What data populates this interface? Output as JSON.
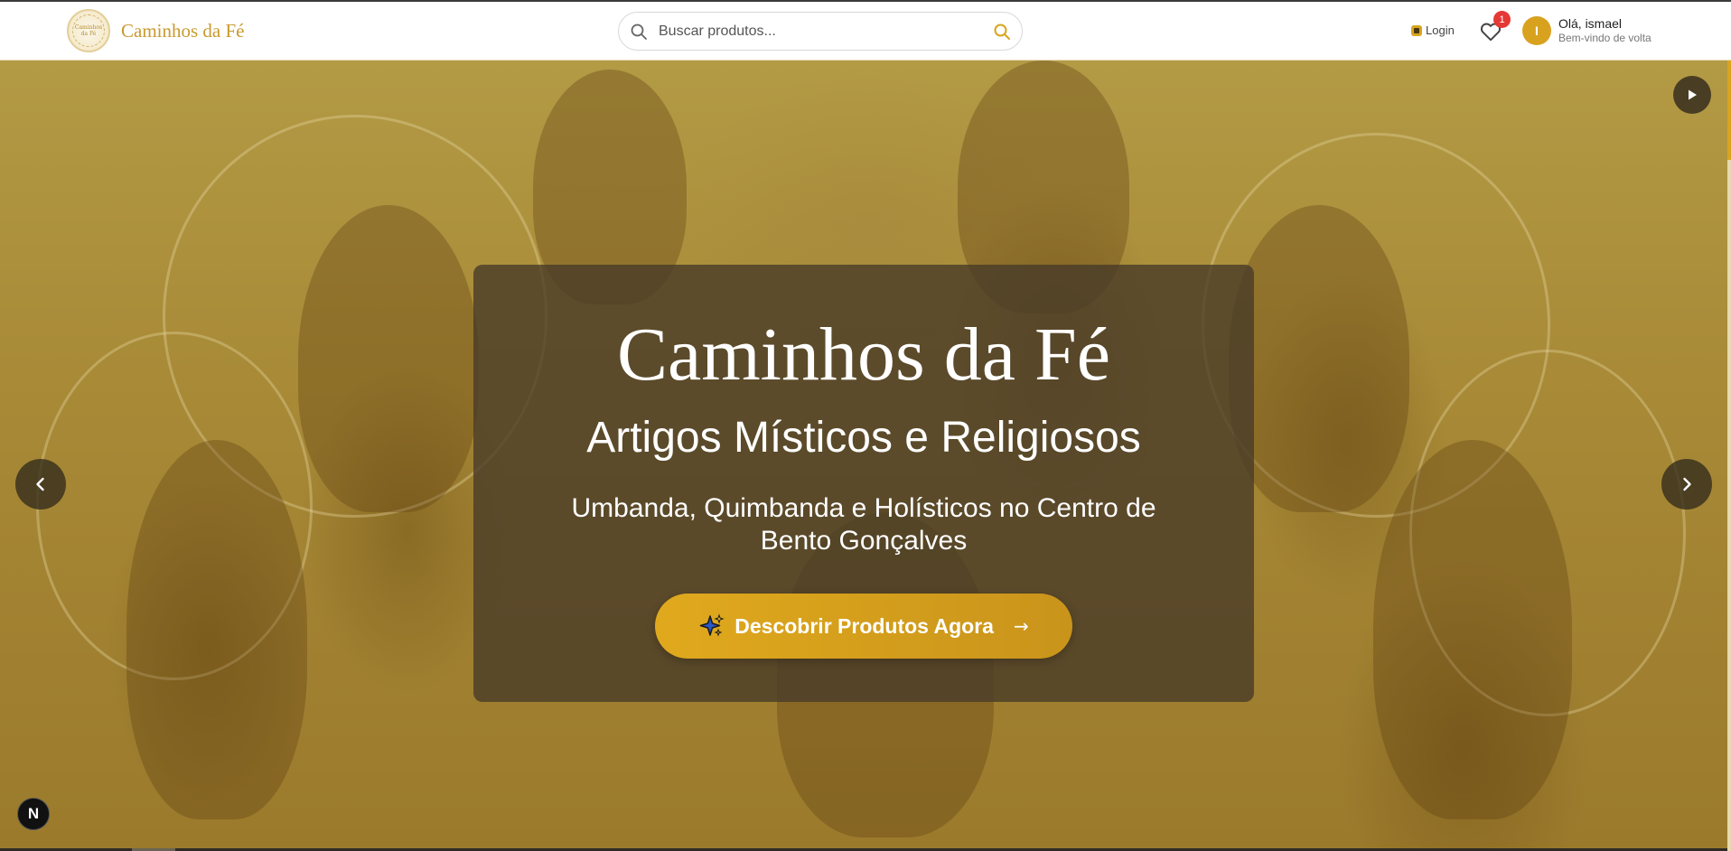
{
  "header": {
    "brand_name": "Caminhos da Fé",
    "logo_text": "Caminhos da Fé",
    "search": {
      "placeholder": "Buscar produtos..."
    },
    "login_label": "Login",
    "favorites_count": "1",
    "user": {
      "initial": "I",
      "greeting": "Olá, ismael",
      "subtitle": "Bem-vindo de volta"
    }
  },
  "hero": {
    "title": "Caminhos da Fé",
    "subtitle": "Artigos Místicos e Religiosos",
    "description": "Umbanda, Quimbanda e Holísticos no Centro de Bento Gonçalves",
    "cta_label": "Descobrir Produtos Agora",
    "cta_icon": "sparkles-icon",
    "cta_arrow": "→"
  },
  "misc": {
    "dev_badge": "N"
  },
  "colors": {
    "accent": "#d9a520",
    "brand_text": "#c99a2e",
    "badge": "#e53935"
  }
}
